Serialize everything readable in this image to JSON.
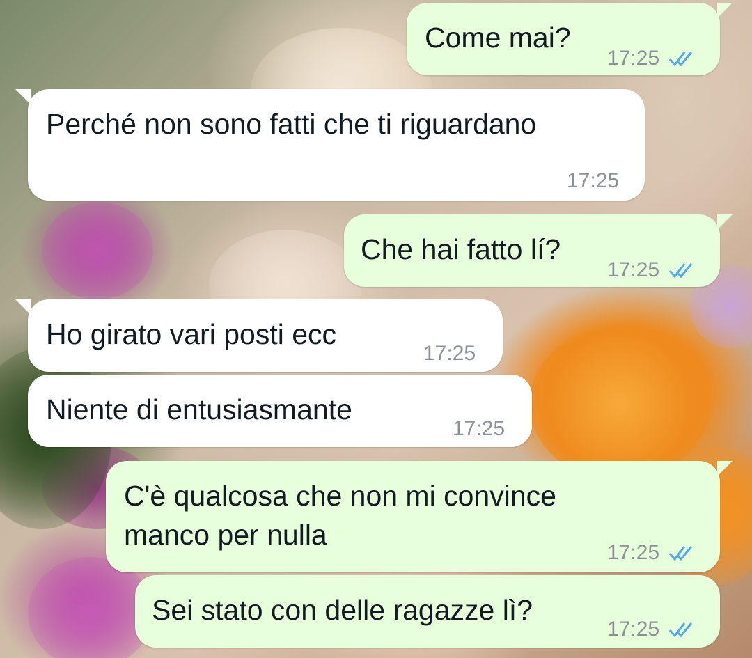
{
  "wallpaper": {
    "description_colors": [
      "#f39a2c",
      "#b4489e",
      "#3d5a2a",
      "#e9d6c0"
    ]
  },
  "colors": {
    "outgoing_bubble": "#e7ffdb",
    "incoming_bubble": "#ffffff",
    "read_tick": "#4fa8e8",
    "timestamp": "#8a9197"
  },
  "messages": [
    {
      "direction": "out",
      "text": "Come mai?",
      "time": "17:25",
      "status": "read-ticks-icon"
    },
    {
      "direction": "in",
      "text": "Perché non sono fatti che ti riguardano",
      "time": "17:25"
    },
    {
      "direction": "out",
      "text": "Che hai fatto lí?",
      "time": "17:25",
      "status": "read-ticks-icon"
    },
    {
      "direction": "in",
      "text": "Ho girato vari posti ecc",
      "time": "17:25"
    },
    {
      "direction": "in",
      "text": "Niente di entusiasmante",
      "time": "17:25"
    },
    {
      "direction": "out",
      "text": "C'è qualcosa che non mi convince\nmanco per nulla",
      "time": "17:25",
      "status": "read-ticks-icon"
    },
    {
      "direction": "out",
      "text": "Sei stato con delle ragazze lì?",
      "time": "17:25",
      "status": "read-ticks-icon"
    }
  ]
}
